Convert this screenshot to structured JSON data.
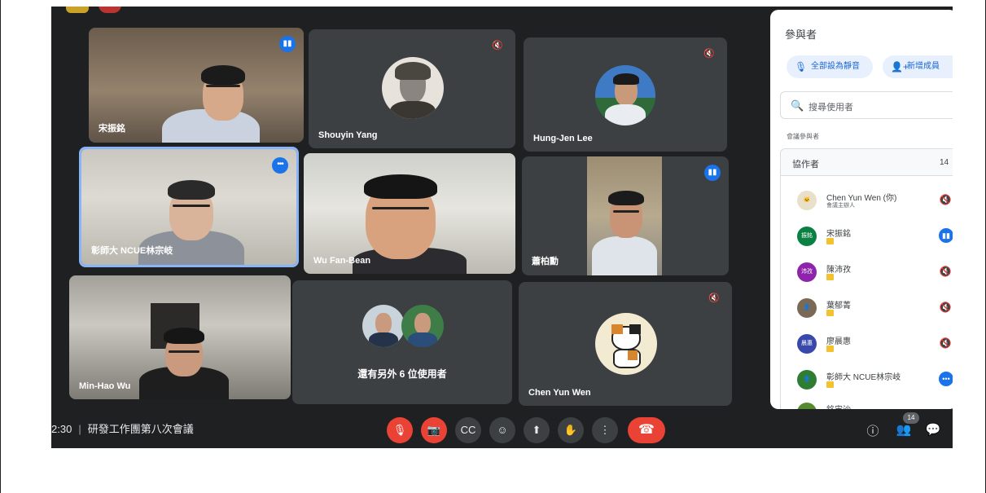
{
  "tiles": [
    {
      "name": "宋振銘",
      "state": "talking"
    },
    {
      "name": "Shouyin Yang",
      "state": "muted"
    },
    {
      "name": "Hung-Jen Lee",
      "state": "muted"
    },
    {
      "name": "彰師大 NCUE林宗岐",
      "state": "more"
    },
    {
      "name": "Wu Fan-Bean",
      "state": "none"
    },
    {
      "name": "蕭柏勳",
      "state": "talking"
    },
    {
      "name": "Min-Hao Wu",
      "state": "none"
    },
    {
      "name": "還有另外 6 位使用者",
      "state": "none"
    },
    {
      "name": "Chen Yun Wen",
      "state": "muted"
    }
  ],
  "sidebar": {
    "title": "參與者",
    "mute_all": "全部設為靜音",
    "add_people": "新增成員",
    "search_placeholder": "搜尋使用者",
    "section": "會議參與者",
    "group_label": "協作者",
    "group_count": "14",
    "participants": [
      {
        "name": "Chen Yun Wen (你)",
        "sub": "會議主辦人",
        "avatar_color": "#e8e0c8",
        "initials": "",
        "state": "muted"
      },
      {
        "name": "宋振銘",
        "sub": "",
        "avatar_color": "#0b8043",
        "initials": "振銘",
        "state": "talking"
      },
      {
        "name": "陳沛孜",
        "sub": "",
        "avatar_color": "#8e24aa",
        "initials": "沛孜",
        "state": "muted"
      },
      {
        "name": "葉郁菁",
        "sub": "",
        "avatar_color": "#7a6a55",
        "initials": "",
        "state": "muted"
      },
      {
        "name": "廖晨惠",
        "sub": "",
        "avatar_color": "#3949ab",
        "initials": "晨惠",
        "state": "muted"
      },
      {
        "name": "彰師大 NCUE林宗岐",
        "sub": "",
        "avatar_color": "#2e7d32",
        "initials": "",
        "state": "more"
      },
      {
        "name": "銘宙沙",
        "sub": "",
        "avatar_color": "#558b2f",
        "initials": "",
        "state": "muted"
      }
    ]
  },
  "bottom": {
    "time": "2:30",
    "meeting_title": "研發工作團第八次會議",
    "people_count": "14"
  },
  "icons": {
    "mic_off": "mic-off-icon",
    "cam_off": "camera-off-icon",
    "captions": "captions-icon",
    "emoji": "emoji-icon",
    "present": "present-icon",
    "hand": "raise-hand-icon",
    "more": "more-vert-icon",
    "leave": "leave-call-icon",
    "info": "info-icon",
    "people": "people-icon",
    "chat": "chat-icon"
  },
  "colors": {
    "accent": "#1a73e8",
    "danger": "#ea4335",
    "tile_bg": "#3c4043",
    "screen_bg": "#1f2022"
  }
}
